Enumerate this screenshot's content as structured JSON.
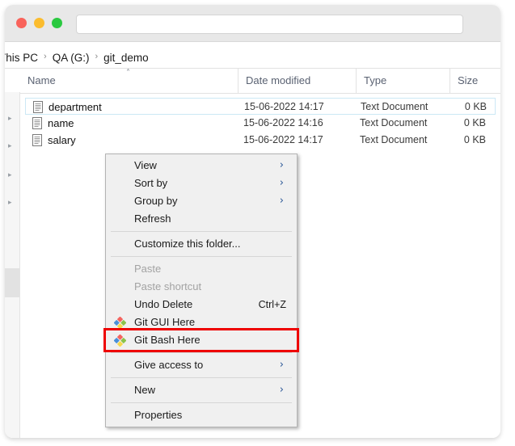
{
  "window": {
    "controls": [
      {
        "name": "close",
        "color": "#f9635b"
      },
      {
        "name": "minimize",
        "color": "#fbbc2e"
      },
      {
        "name": "maximize",
        "color": "#2ac940"
      }
    ],
    "address_bar": {
      "value": "",
      "placeholder": ""
    }
  },
  "breadcrumb": {
    "items": [
      "This PC",
      "QA (G:)",
      "git_demo"
    ],
    "separator": "›"
  },
  "columns": {
    "name": "Name",
    "date_modified": "Date modified",
    "type": "Type",
    "size": "Size",
    "sort_indicator": "˄"
  },
  "files": [
    {
      "name": "department",
      "date_modified": "15-06-2022 14:17",
      "type": "Text Document",
      "size": "0 KB",
      "selected": true
    },
    {
      "name": "name",
      "date_modified": "15-06-2022 14:16",
      "type": "Text Document",
      "size": "0 KB",
      "selected": false
    },
    {
      "name": "salary",
      "date_modified": "15-06-2022 14:17",
      "type": "Text Document",
      "size": "0 KB",
      "selected": false
    }
  ],
  "context_menu": {
    "items": [
      {
        "label": "View",
        "submenu": true,
        "disabled": false,
        "icon": null,
        "shortcut": null
      },
      {
        "label": "Sort by",
        "submenu": true,
        "disabled": false,
        "icon": null,
        "shortcut": null
      },
      {
        "label": "Group by",
        "submenu": true,
        "disabled": false,
        "icon": null,
        "shortcut": null
      },
      {
        "label": "Refresh",
        "submenu": false,
        "disabled": false,
        "icon": null,
        "shortcut": null
      },
      {
        "label": "Customize this folder...",
        "submenu": false,
        "disabled": false,
        "icon": null,
        "shortcut": null
      },
      {
        "label": "Paste",
        "submenu": false,
        "disabled": true,
        "icon": null,
        "shortcut": null
      },
      {
        "label": "Paste shortcut",
        "submenu": false,
        "disabled": true,
        "icon": null,
        "shortcut": null
      },
      {
        "label": "Undo Delete",
        "submenu": false,
        "disabled": false,
        "icon": null,
        "shortcut": "Ctrl+Z"
      },
      {
        "label": "Git GUI Here",
        "submenu": false,
        "disabled": false,
        "icon": "git-icon",
        "shortcut": null
      },
      {
        "label": "Git Bash Here",
        "submenu": false,
        "disabled": false,
        "icon": "git-icon",
        "shortcut": null
      },
      {
        "label": "Give access to",
        "submenu": true,
        "disabled": false,
        "icon": null,
        "shortcut": null
      },
      {
        "label": "New",
        "submenu": true,
        "disabled": false,
        "icon": null,
        "shortcut": null
      },
      {
        "label": "Properties",
        "submenu": false,
        "disabled": false,
        "icon": null,
        "shortcut": null
      }
    ],
    "submenu_arrow": "›",
    "highlighted_item": "Git Bash Here"
  },
  "colors": {
    "highlight_box": "#ee0000",
    "menu_background": "#f0f0f0",
    "menu_border": "#b4b4b4",
    "submenu_arrow": "#2b5797",
    "selection_border": "#cce8f5",
    "git_icon_top": "#f4645f",
    "git_icon_right": "#8bc34a",
    "git_icon_left": "#4a90d9",
    "git_icon_bottom": "#f7d94c"
  }
}
